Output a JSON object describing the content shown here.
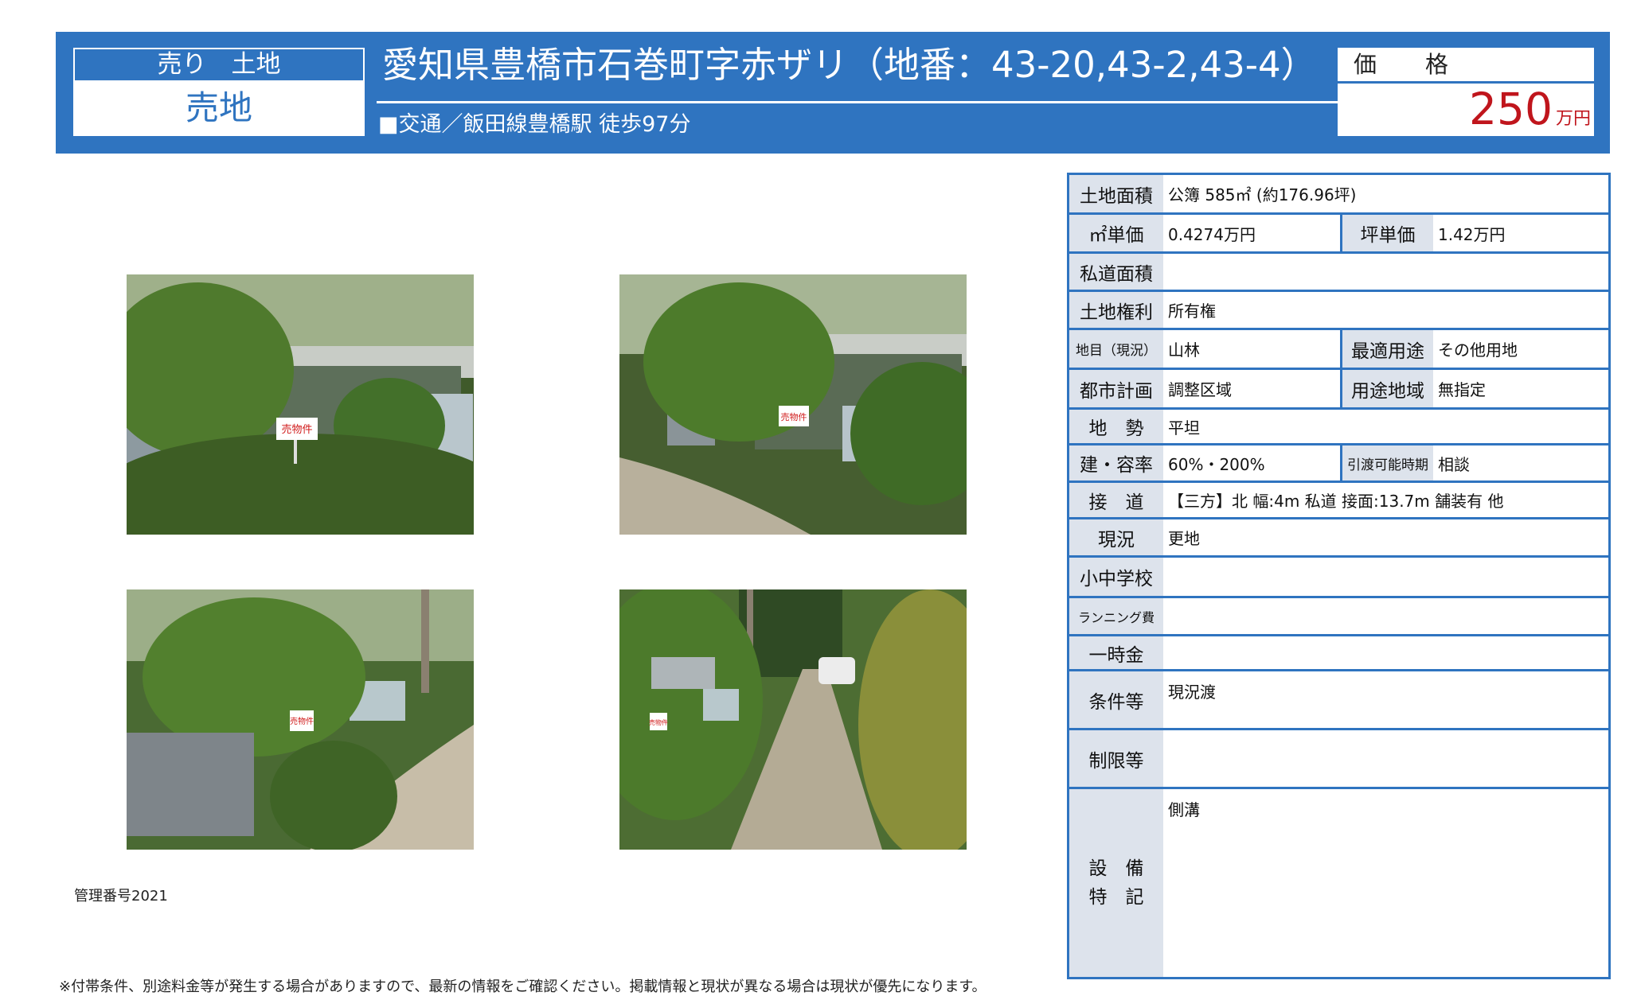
{
  "header": {
    "category_top": "売り　土地",
    "category_main": "売地",
    "title": "愛知県豊橋市石巻町字赤ザリ（地番：43-20,43-2,43-4）",
    "access": "■交通／飯田線豊橋駅 徒歩97分",
    "price_label": "価　格",
    "price_value": "250",
    "price_unit": "万円"
  },
  "photos": [
    {
      "icon": "land-photo-1"
    },
    {
      "icon": "land-photo-2"
    },
    {
      "icon": "land-photo-3"
    },
    {
      "icon": "land-photo-4"
    }
  ],
  "sign_text": "売物件",
  "management_number": "管理番号2021",
  "footnote": "※付帯条件、別途料金等が発生する場合がありますので、最新の情報をご確認ください。掲載情報と現状が異なる場合は現状が優先になります。",
  "specs": {
    "land_area": {
      "label": "土地面積",
      "value": "公簿 585㎡ (約176.96坪)"
    },
    "sqm_price": {
      "label": "㎡単価",
      "value": "0.4274万円"
    },
    "tsubo_price": {
      "label": "坪単価",
      "value": "1.42万円"
    },
    "private_road": {
      "label": "私道面積",
      "value": ""
    },
    "land_rights": {
      "label": "土地権利",
      "value": "所有権"
    },
    "land_category": {
      "label": "地目（現況）",
      "value": "山林"
    },
    "best_use": {
      "label": "最適用途",
      "value": "その他用地"
    },
    "city_planning": {
      "label": "都市計画",
      "value": "調整区域"
    },
    "zoning": {
      "label": "用途地域",
      "value": "無指定"
    },
    "terrain": {
      "label": "地　勢",
      "value": "平坦"
    },
    "coverage": {
      "label": "建・容率",
      "value": "60%・200%"
    },
    "handover": {
      "label": "引渡可能時期",
      "value": "相談"
    },
    "road_access": {
      "label": "接　道",
      "value": "【三方】北 幅:4m 私道 接面:13.7m 舗装有 他"
    },
    "current_status": {
      "label": "現況",
      "value": "更地"
    },
    "schools": {
      "label": "小中学校",
      "value": ""
    },
    "running_cost": {
      "label": "ランニング費",
      "value": ""
    },
    "lump_sum": {
      "label": "一時金",
      "value": ""
    },
    "conditions": {
      "label": "条件等",
      "value": "現況渡"
    },
    "restrictions": {
      "label": "制限等",
      "value": ""
    },
    "facilities_label_1": "設　備",
    "facilities_label_2": "特　記",
    "facilities_value": "側溝"
  },
  "colors": {
    "brand_blue": "#2f74c0",
    "label_bg": "#dde3ec",
    "price_red": "#c0151c"
  }
}
